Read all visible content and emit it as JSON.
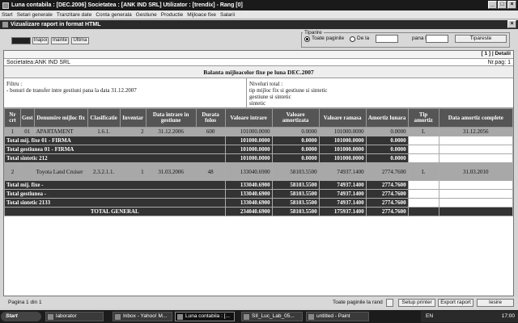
{
  "window": {
    "title": "Luna contabila : [DEC.2006]      Societatea : [ANK IND SRL]      Utilizator : [trendix] - Rang [0]"
  },
  "menu": [
    "Start",
    "Setari generale",
    "Tranzitare date",
    "Conta generala",
    "Gestiune",
    "Productie",
    "Mijloace fixe",
    "Salarii"
  ],
  "child": {
    "title": "Vizualizare raport in format HTML"
  },
  "nav": {
    "first": "",
    "back": "Inapoi",
    "forward": "Inainte",
    "last": "Ultima"
  },
  "print": {
    "legend": "Tiparire",
    "all_pages": "Toate paginile",
    "from": "De la",
    "to": "pana la",
    "from_value": "",
    "to_value": "",
    "button": "Tipareste"
  },
  "report": {
    "top_right": "[ 1 ] | Detalii",
    "company": "Societatea:ANK IND SRL",
    "page": "Nr.pag: 1",
    "title": "Balanta mijloacelor fixe pe luna DEC.2007",
    "filter_label": "Filtru :",
    "filter_value": "- bonuri de transfer intre gestiuni pana la data 31.12.2007",
    "levels_label": "Niveluri total :",
    "levels_1": "tip mijloc fix si gestiune si sintetic",
    "levels_2": "gestiune si sintetic",
    "levels_3": "sintetic",
    "columns": [
      "Nr crt",
      "Gest",
      "Denumire mijloc fix",
      "Clasificatie",
      "Inventar",
      "Data intrare in gestiune",
      "Durata folos",
      "Valoare intrare",
      "Valoare amortizata",
      "Valoare ramasa",
      "Amortiz lunara",
      "Tip amortiz",
      "Data amortiz complete"
    ],
    "rows": [
      {
        "nr": "1",
        "gest": "01",
        "name": "APARTAMENT",
        "clas": "1.6.1.",
        "inv": "2",
        "date_in": "31.12.2006",
        "dur": "600",
        "val_in": "101000.0000",
        "val_am": "0.0000",
        "val_rem": "101000.0000",
        "am_month": "0.0000",
        "tip": "L",
        "date_full": "31.12.2056"
      },
      {
        "label": "Total mij. fixe 01 - FIRMA",
        "val_in": "101000.0000",
        "val_am": "0.0000",
        "val_rem": "101000.0000",
        "am_month": "0.0000"
      },
      {
        "label": "Total gestiunea 01 - FIRMA",
        "val_in": "101000.0000",
        "val_am": "0.0000",
        "val_rem": "101000.0000",
        "am_month": "0.0000"
      },
      {
        "label": "Total sintetic 212",
        "val_in": "101000.0000",
        "val_am": "0.0000",
        "val_rem": "101000.0000",
        "am_month": "0.0000"
      },
      {
        "nr": "2",
        "gest": "",
        "name": "Toyota Land Cruiser",
        "clas": "2.3.2.1.1.",
        "inv": "1",
        "date_in": "31.03.2006",
        "dur": "48",
        "val_in": "133040.6900",
        "val_am": "58103.5500",
        "val_rem": "74937.1400",
        "am_month": "2774.7600",
        "tip": "L",
        "date_full": "31.03.2010"
      },
      {
        "label": "Total mij. fixe -",
        "val_in": "133040.6900",
        "val_am": "58103.5500",
        "val_rem": "74937.1400",
        "am_month": "2774.7600"
      },
      {
        "label": "Total gestiunea -",
        "val_in": "133040.6900",
        "val_am": "58103.5500",
        "val_rem": "74937.1400",
        "am_month": "2774.7600"
      },
      {
        "label": "Total sintetic 2133",
        "val_in": "133040.6900",
        "val_am": "58103.5500",
        "val_rem": "74937.1400",
        "am_month": "2774.7600"
      },
      {
        "label": "TOTAL GENERAL",
        "val_in": "234040.6900",
        "val_am": "58103.5500",
        "val_rem": "175937.1400",
        "am_month": "2774.7600"
      }
    ]
  },
  "status": {
    "page_info": "Pagina 1 din 1",
    "all_pages_in_row": "Toate paginile la rand",
    "setup_printer": "Setup printer",
    "export": "Export raport",
    "exit": "Iesire"
  },
  "taskbar": {
    "start": "Start",
    "items": [
      "laborator",
      "Inbox - Yahoo! M...",
      "Luna contabila : [...",
      "SII_Luc_Lab_05...",
      "untitled - Paint"
    ],
    "lang": "EN",
    "clock": "17:00"
  }
}
